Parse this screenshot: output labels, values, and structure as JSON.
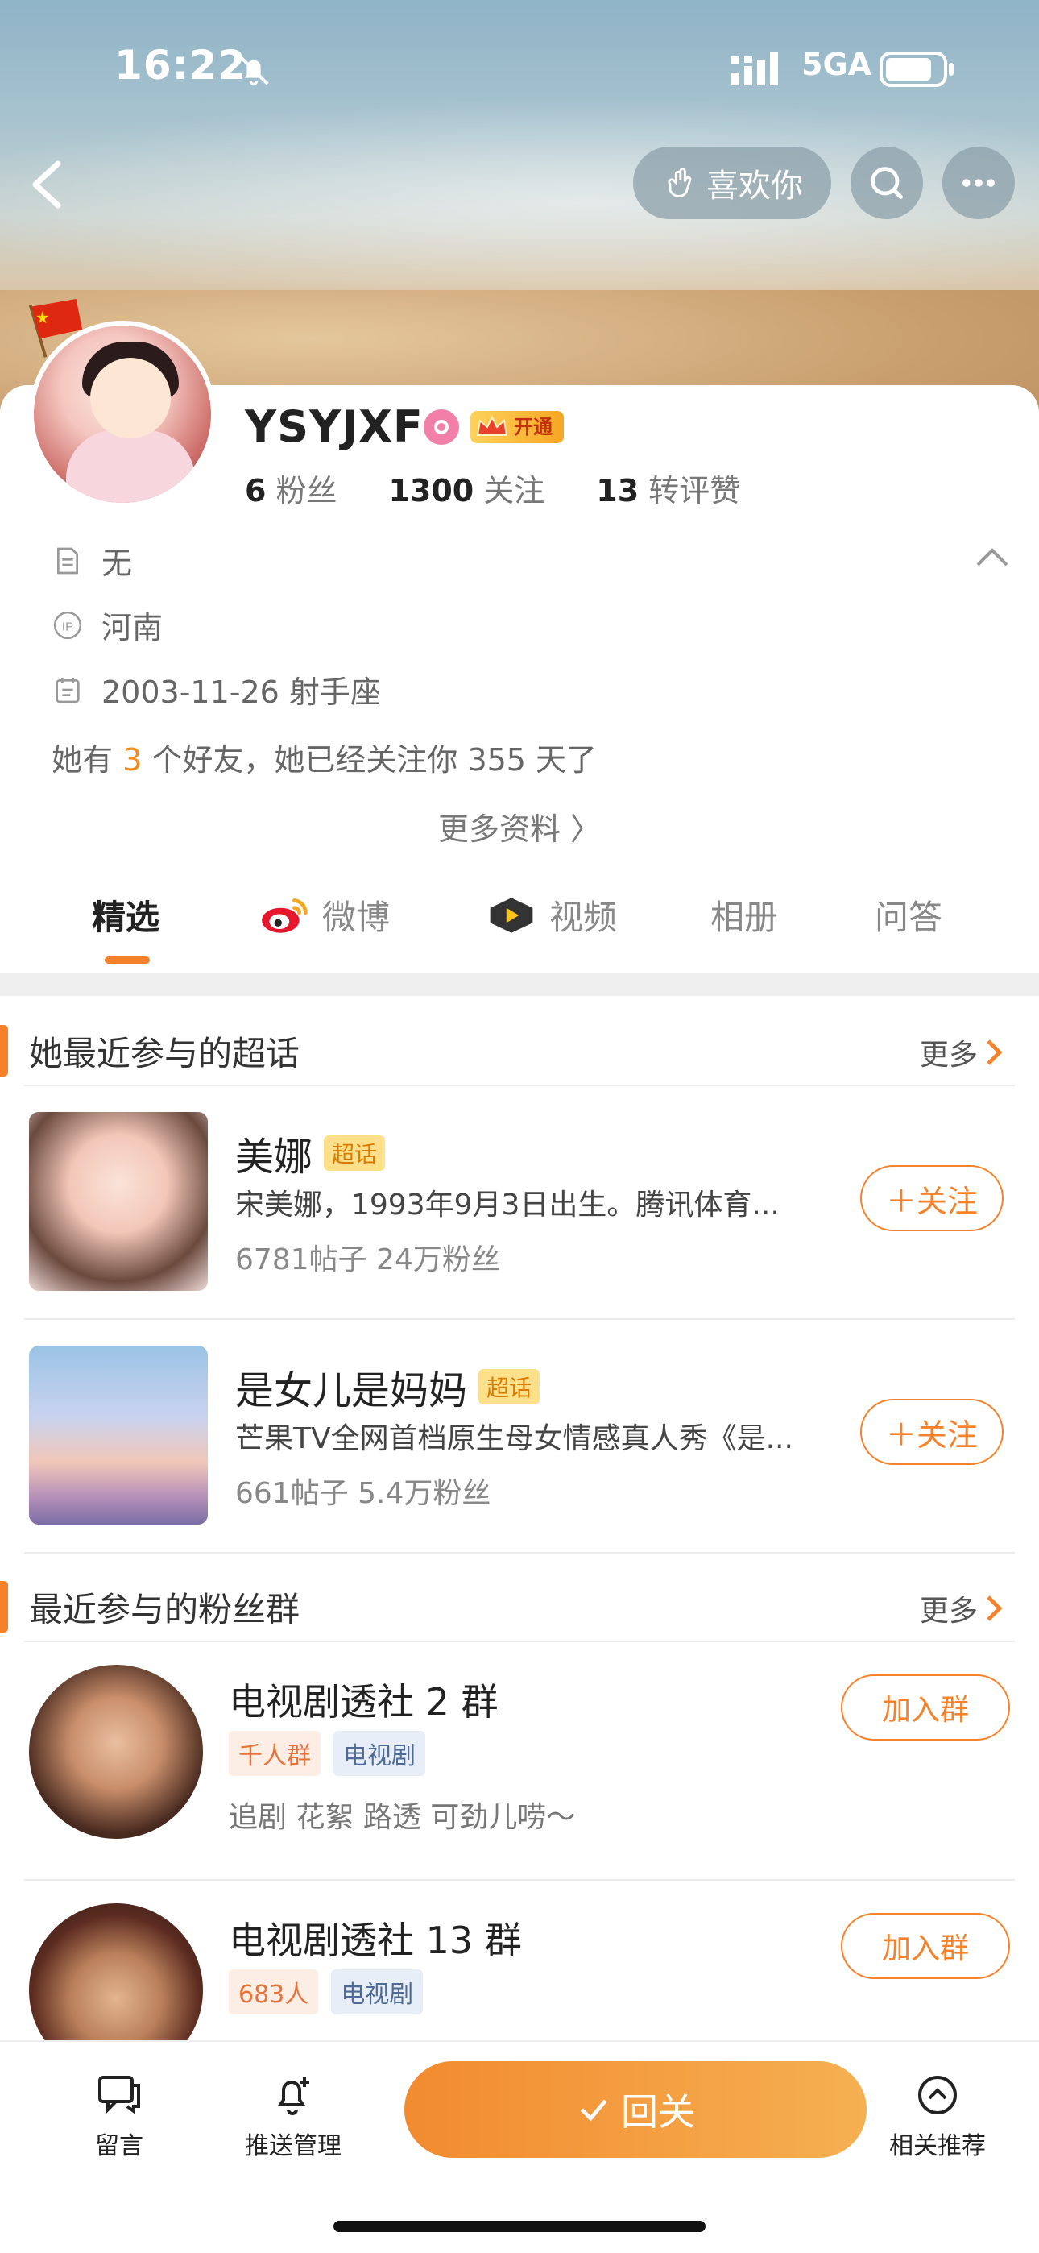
{
  "status_bar": {
    "time": "16:22",
    "network": "5GA"
  },
  "header": {
    "like_label": "喜欢你"
  },
  "profile": {
    "name": "YSYJXF",
    "vip_label": "开通",
    "stats": [
      {
        "num": "6",
        "label": "粉丝"
      },
      {
        "num": "1300",
        "label": "关注"
      },
      {
        "num": "13",
        "label": "转评赞"
      }
    ],
    "bio": "无",
    "ip_location": "河南",
    "birthday": "2003-11-26 射手座",
    "friends_prefix": "她有 ",
    "friends_count": "3",
    "friends_suffix": " 个好友，她已经关注你 355 天了",
    "more_info": "更多资料 〉"
  },
  "tabs": [
    "精选",
    "微博",
    "视频",
    "相册",
    "问答"
  ],
  "supertopics": {
    "title": "她最近参与的超话",
    "more": "更多",
    "tag": "超话",
    "follow_label": "＋关注",
    "items": [
      {
        "name": "美娜",
        "desc": "宋美娜，1993年9月3日出生。腾讯体育...",
        "stats": "6781帖子 24万粉丝"
      },
      {
        "name": "是女儿是妈妈",
        "desc": "芒果TV全网首档原生母女情感真人秀《是...",
        "stats": "661帖子 5.4万粉丝"
      }
    ]
  },
  "fan_groups": {
    "title": "最近参与的粉丝群",
    "more": "更多",
    "join_label": "加入群",
    "items": [
      {
        "name": "电视剧透社 2 群",
        "tag1": "千人群",
        "tag2": "电视剧",
        "desc": "追剧 花絮 路透 可劲儿唠～"
      },
      {
        "name": "电视剧透社 13 群",
        "tag1": "683人",
        "tag2": "电视剧",
        "desc": ""
      }
    ]
  },
  "bottom_bar": {
    "message": "留言",
    "push": "推送管理",
    "return": "回关",
    "related": "相关推荐"
  },
  "colors": {
    "accent": "#f5822a",
    "vip_gold": "#f5a623"
  }
}
